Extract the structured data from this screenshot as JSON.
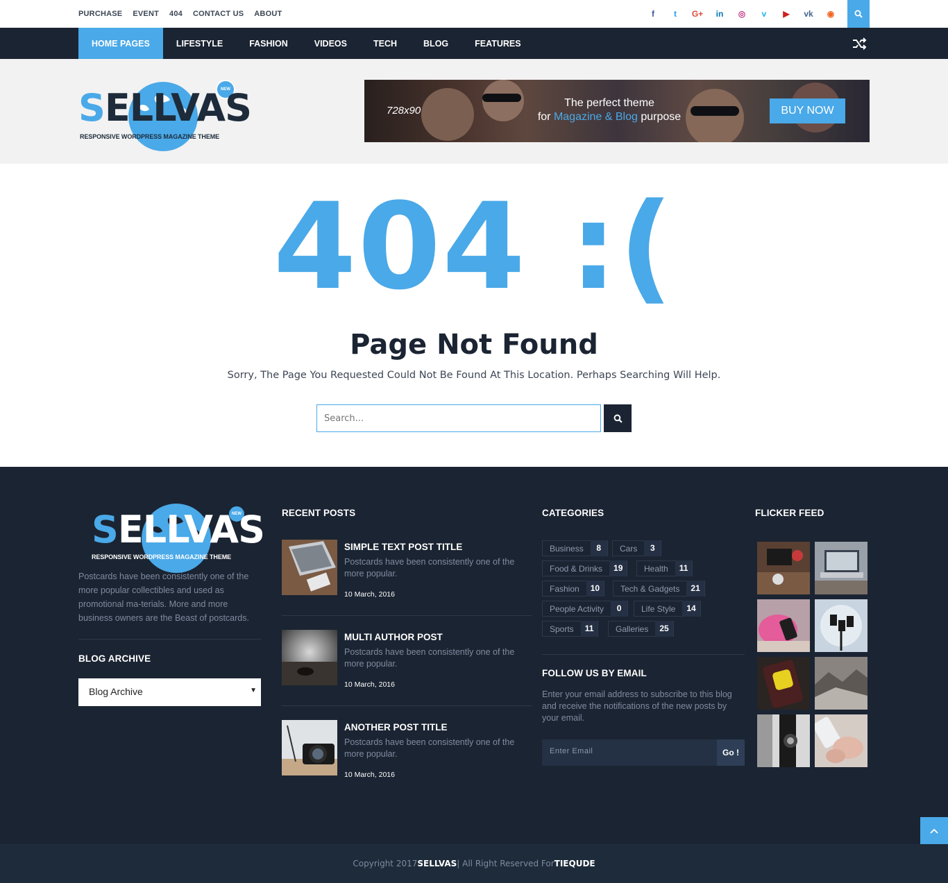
{
  "topbar": {
    "links": [
      "PURCHASE",
      "EVENT",
      "404",
      "CONTACT US",
      "ABOUT"
    ],
    "social": [
      {
        "icon": "facebook-icon",
        "glyph": "f",
        "color": "#3b5998"
      },
      {
        "icon": "twitter-icon",
        "glyph": "t",
        "color": "#1da1f2"
      },
      {
        "icon": "google-plus-icon",
        "glyph": "G+",
        "color": "#dd4b39"
      },
      {
        "icon": "linkedin-icon",
        "glyph": "in",
        "color": "#0077b5"
      },
      {
        "icon": "instagram-icon",
        "glyph": "◎",
        "color": "#c13584"
      },
      {
        "icon": "vimeo-icon",
        "glyph": "v",
        "color": "#1ab7ea"
      },
      {
        "icon": "youtube-icon",
        "glyph": "▶",
        "color": "#cd201f"
      },
      {
        "icon": "vk-icon",
        "glyph": "vk",
        "color": "#45668e"
      },
      {
        "icon": "rss-icon",
        "glyph": "◉",
        "color": "#f26522"
      }
    ]
  },
  "nav": {
    "items": [
      "HOME PAGES",
      "LIFESTYLE",
      "FASHION",
      "VIDEOS",
      "TECH",
      "BLOG",
      "FEATURES"
    ],
    "active_index": 0
  },
  "header": {
    "logo_word_first": "S",
    "logo_word_rest": "ELLVAS",
    "logo_badge": "NEW",
    "logo_tagline": "RESPONSIVE WORDPRESS MAGAZINE THEME",
    "banner": {
      "size_label": "728x90",
      "line1": "The perfect theme",
      "line2_prefix": "for ",
      "line2_highlight": "Magazine & Blog",
      "line2_suffix": " purpose",
      "button": "BUY NOW"
    }
  },
  "error": {
    "code": "404 :(",
    "title": "Page Not Found",
    "message": "Sorry, The Page You Requested Could Not Be Found At This Location. Perhaps Searching Will Help.",
    "search_placeholder": "Search..."
  },
  "footer": {
    "about": {
      "logo_word_first": "S",
      "logo_word_rest": "ELLVAS",
      "logo_badge": "NEW",
      "logo_tagline": "RESPONSIVE WORDPRESS MAGAZINE THEME",
      "description": "Postcards have been consistently one of the more popular collectibles and used as promotional ma-terials. More and more business owners are the Beast of postcards."
    },
    "archive": {
      "heading": "BLOG ARCHIVE",
      "selected": "Blog Archive"
    },
    "recent": {
      "heading": "RECENT POSTS",
      "posts": [
        {
          "title": "SIMPLE TEXT POST TITLE",
          "desc": "Postcards have been consistently one of the more popular.",
          "date": "10 March, 2016"
        },
        {
          "title": "MULTI AUTHOR POST",
          "desc": "Postcards have been consistently one of the more popular.",
          "date": "10 March, 2016"
        },
        {
          "title": "ANOTHER POST TITLE",
          "desc": "Postcards have been consistently one of the more popular.",
          "date": "10 March, 2016"
        }
      ]
    },
    "categories": {
      "heading": "CATEGORIES",
      "items": [
        {
          "name": "Business",
          "count": "8"
        },
        {
          "name": "Cars",
          "count": "3"
        },
        {
          "name": "Food & Drinks",
          "count": "19"
        },
        {
          "name": "Health",
          "count": "11"
        },
        {
          "name": "Fashion",
          "count": "10"
        },
        {
          "name": "Tech & Gadgets",
          "count": "21"
        },
        {
          "name": "People Activity",
          "count": "0"
        },
        {
          "name": "Life Style",
          "count": "14"
        },
        {
          "name": "Sports",
          "count": "11"
        },
        {
          "name": "Galleries",
          "count": "25"
        }
      ]
    },
    "follow": {
      "heading": "FOLLOW US BY EMAIL",
      "desc": "Enter your email address to subscribe to this blog and receive the notifications of the new posts by your email.",
      "placeholder": "Enter Email",
      "button": "Go !"
    },
    "flicker": {
      "heading": "FLICKER FEED"
    }
  },
  "copyright": {
    "prefix": "Copyright 2017 ",
    "brand": "SELLVAS",
    "middle": " | All Right Reserved For ",
    "owner": "TIEQUDE"
  }
}
